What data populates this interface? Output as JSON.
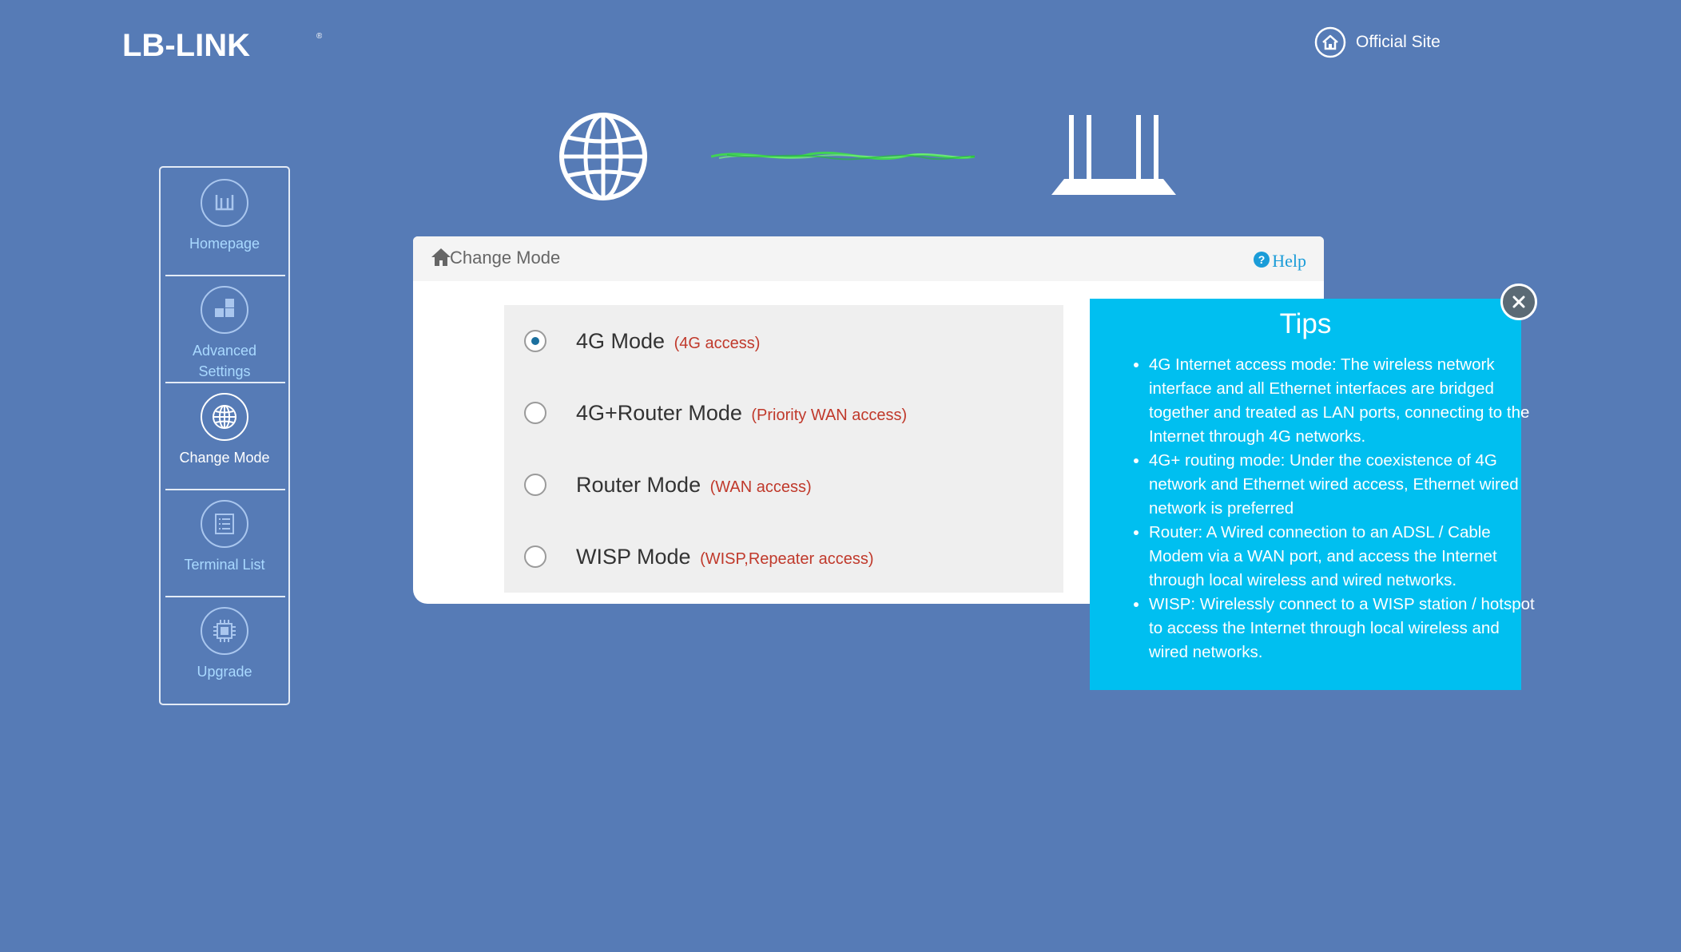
{
  "header": {
    "brand": "LB-LINK",
    "official_site": "Official Site"
  },
  "sidebar": {
    "items": [
      {
        "label": "Homepage",
        "icon": "router-icon",
        "active": false
      },
      {
        "label": "Advanced Settings",
        "icon": "grid-icon",
        "active": false
      },
      {
        "label": "Change Mode",
        "icon": "globe-icon",
        "active": true
      },
      {
        "label": "Terminal List",
        "icon": "list-icon",
        "active": false
      },
      {
        "label": "Upgrade",
        "icon": "chip-icon",
        "active": false
      }
    ]
  },
  "panel": {
    "title": "Change Mode",
    "help_label": "Help",
    "modes": [
      {
        "name": "4G Mode",
        "sub": "(4G access)",
        "checked": true
      },
      {
        "name": "4G+Router Mode",
        "sub": "(Priority WAN access)",
        "checked": false
      },
      {
        "name": "Router Mode",
        "sub": "(WAN access)",
        "checked": false
      },
      {
        "name": "WISP Mode",
        "sub": "(WISP,Repeater access)",
        "checked": false
      }
    ]
  },
  "tips": {
    "title": "Tips",
    "items": [
      "4G Internet access mode: The wireless network interface and all Ethernet interfaces are bridged together and treated as LAN ports, connecting to the Internet through 4G networks.",
      "4G+ routing mode: Under the coexistence of 4G network and Ethernet wired access, Ethernet wired network is preferred",
      "Router: A Wired connection to an ADSL / Cable Modem via a WAN port, and access the Internet through local wireless and wired networks.",
      "WISP: Wirelessly connect to a WISP station / hotspot to access the Internet through local wireless and wired networks."
    ]
  },
  "colors": {
    "background": "#567bb6",
    "tips_bg": "#00bff0",
    "accent_red": "#c0392b",
    "help_blue": "#1a9cd8"
  }
}
